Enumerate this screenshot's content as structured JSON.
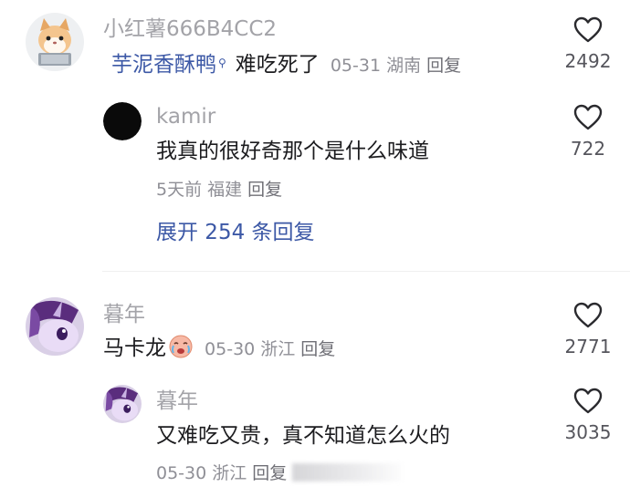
{
  "comments": [
    {
      "username": "小红薯666B4CC2",
      "mention": "芋泥香酥鸭",
      "mention_icon": "search-icon",
      "content": "难吃死了",
      "date": "05-31",
      "location": "湖南",
      "reply_label": "回复",
      "likes": "2492",
      "avatar_icon": "cat-with-laptop-avatar",
      "replies": [
        {
          "username": "kamir",
          "content": "我真的很好奇那个是什么味道",
          "date": "5天前",
          "location": "福建",
          "reply_label": "回复",
          "likes": "722",
          "avatar_icon": "black-circle-avatar"
        }
      ],
      "expand_label": "展开 254 条回复"
    },
    {
      "username": "暮年",
      "content": "马卡龙",
      "emoji_icon": "crying-emoji-icon",
      "date": "05-30",
      "location": "浙江",
      "reply_label": "回复",
      "likes": "2771",
      "avatar_icon": "purple-pony-avatar",
      "replies": [
        {
          "username": "暮年",
          "content": "又难吃又贵，真不知道怎么火的",
          "date": "05-30",
          "location": "浙江",
          "reply_label": "回复",
          "likes": "3035",
          "avatar_icon": "purple-pony-avatar"
        }
      ]
    }
  ],
  "colors": {
    "username": "#a3a3a8",
    "content": "#1c1c1f",
    "meta": "#8f8f96",
    "link": "#3c58a6",
    "divider": "#efefef"
  }
}
